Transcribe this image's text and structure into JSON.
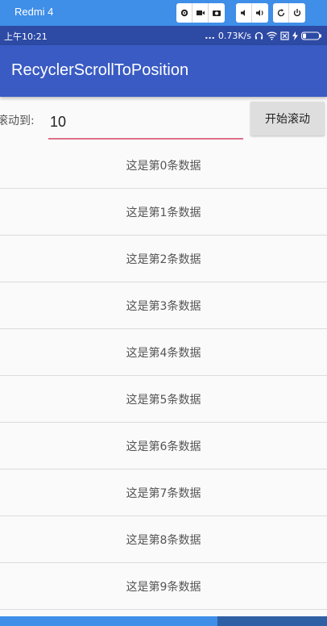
{
  "emulator": {
    "title": "Redmi 4",
    "buttons": [
      "gear-icon",
      "video-icon",
      "camera-icon",
      "volume-down-icon",
      "volume-up-icon",
      "rotate-icon",
      "power-icon"
    ]
  },
  "status_bar": {
    "time": "上午10:21",
    "dots": "...",
    "speed": "0.73K/s",
    "battery_color": "#ffffff"
  },
  "toolbar": {
    "title": "RecyclerScrollToPosition",
    "color": "#3a5bc4"
  },
  "controls": {
    "label": "滚动到:",
    "input_value": "10",
    "input_underline_color": "#e0708a",
    "start_button_label": "开始滚动"
  },
  "list": {
    "items": [
      "这是第0条数据",
      "这是第1条数据",
      "这是第2条数据",
      "这是第3条数据",
      "这是第4条数据",
      "这是第5条数据",
      "这是第6条数据",
      "这是第7条数据",
      "这是第8条数据",
      "这是第9条数据"
    ]
  }
}
